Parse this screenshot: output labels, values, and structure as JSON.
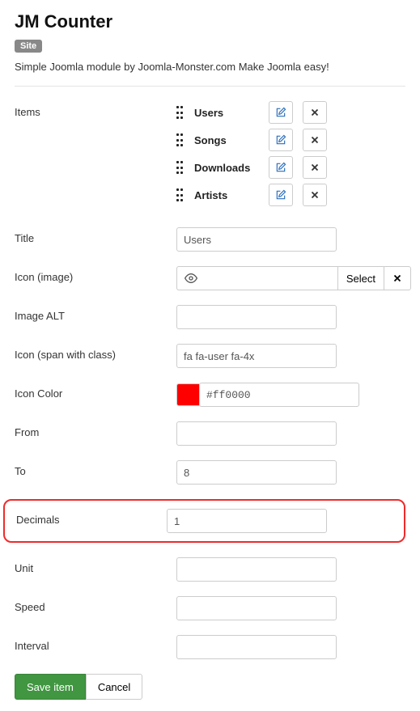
{
  "header": {
    "title": "JM Counter",
    "badge": "Site",
    "description": "Simple Joomla module by Joomla-Monster.com Make Joomla easy!"
  },
  "labels": {
    "items": "Items",
    "title": "Title",
    "icon_image": "Icon (image)",
    "image_alt": "Image ALT",
    "icon_span": "Icon (span with class)",
    "icon_color": "Icon Color",
    "from": "From",
    "to": "To",
    "decimals": "Decimals",
    "unit": "Unit",
    "speed": "Speed",
    "interval": "Interval"
  },
  "items": [
    {
      "name": "Users"
    },
    {
      "name": "Songs"
    },
    {
      "name": "Downloads"
    },
    {
      "name": "Artists"
    }
  ],
  "fields": {
    "title": "Users",
    "icon_image": "",
    "select_label": "Select",
    "image_alt": "",
    "icon_span": "fa fa-user fa-4x",
    "icon_color_hex": "#ff0000",
    "from": "",
    "to": "8",
    "decimals": "1",
    "unit": "",
    "speed": "",
    "interval": ""
  },
  "buttons": {
    "save": "Save item",
    "cancel": "Cancel"
  }
}
